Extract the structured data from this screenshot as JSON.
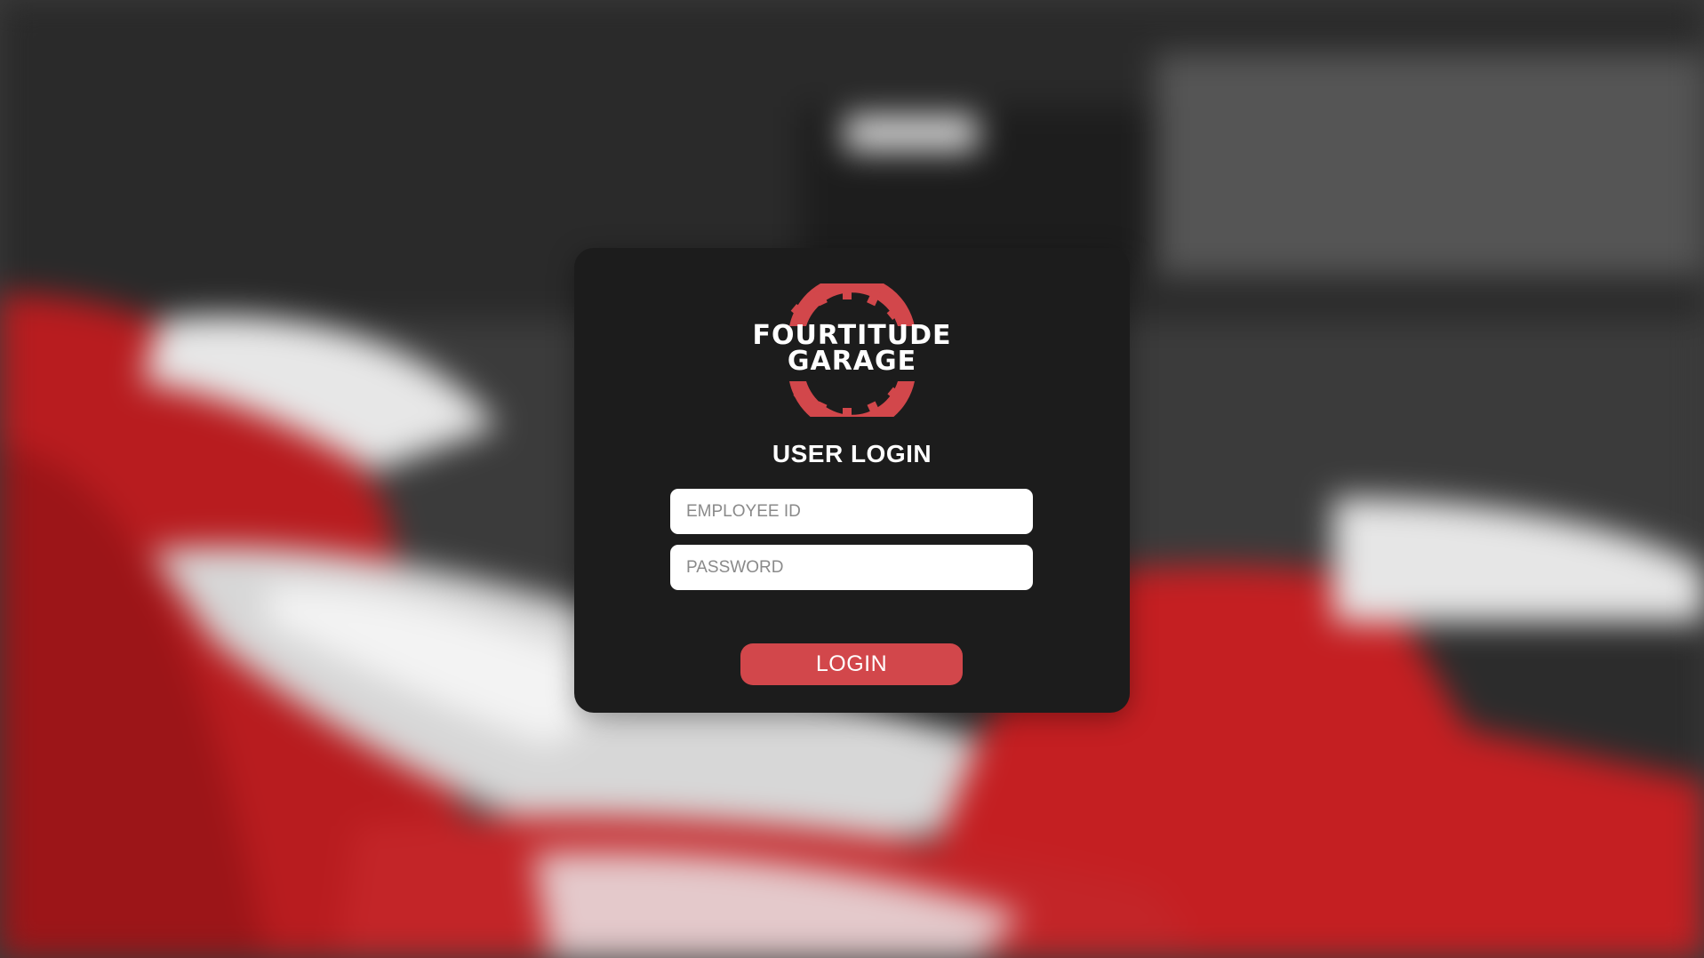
{
  "brand": {
    "name_line1": "FOURTITUDE",
    "name_line2": "GARAGE",
    "accent_color": "#d2474b"
  },
  "login": {
    "heading": "USER LOGIN",
    "employee_id_placeholder": "EMPLOYEE ID",
    "employee_id_value": "",
    "password_placeholder": "PASSWORD",
    "password_value": "",
    "button_label": "LOGIN"
  },
  "icons": {
    "logo": "gear-wheel-logo-icon"
  },
  "colors": {
    "card_background": "#1c1c1c",
    "button_background": "#d2474b",
    "text_primary": "#ffffff"
  }
}
